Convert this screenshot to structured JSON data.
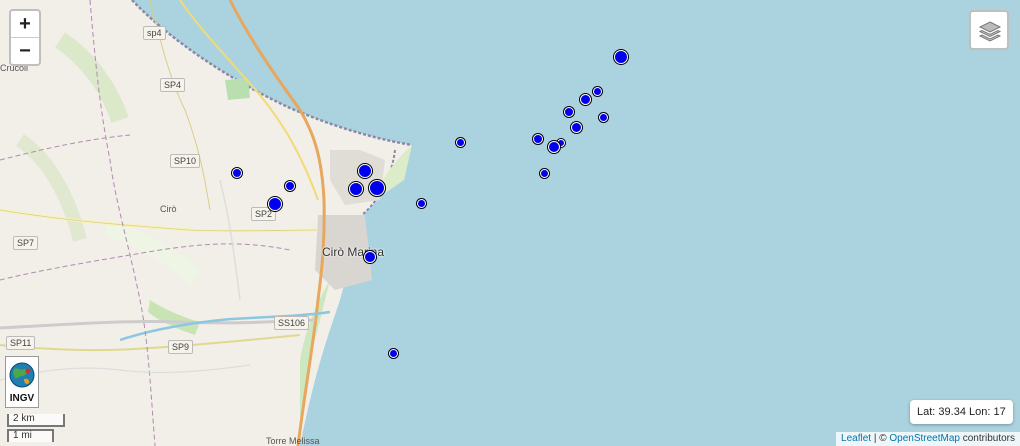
{
  "map": {
    "zoom_in_label": "+",
    "zoom_out_label": "−",
    "layers_icon": "layers-icon",
    "road_labels": [
      "sp4",
      "SP4",
      "SP10",
      "SP2",
      "SP7",
      "SS106",
      "SP9",
      "SP11"
    ],
    "place_labels": [
      "Crucoli",
      "Cirò",
      "Torre Melissa"
    ],
    "town_label": "Cirò Marina",
    "logo": {
      "text": "INGV",
      "icon": "ingv-globe-icon"
    },
    "scale": {
      "metric": "2 km",
      "imperial": "1 mi"
    },
    "coordinates": "Lat: 39.34 Lon: 17",
    "attribution": {
      "leaflet": "Leaflet",
      "separator": " | © ",
      "osm": "OpenStreetMap",
      "suffix": " contributors"
    },
    "colors": {
      "sea": "#aad3df",
      "land": "#f2efe9",
      "marker": "#0000ee"
    },
    "earthquake_markers": [
      {
        "id": "e1",
        "magnitude_class": "large"
      },
      {
        "id": "e2",
        "magnitude_class": "medium"
      },
      {
        "id": "e3",
        "magnitude_class": "medium"
      },
      {
        "id": "e4",
        "magnitude_class": "small"
      },
      {
        "id": "e5",
        "magnitude_class": "medium"
      },
      {
        "id": "e6",
        "magnitude_class": "small"
      },
      {
        "id": "e7",
        "magnitude_class": "medium"
      },
      {
        "id": "e8",
        "magnitude_class": "small"
      },
      {
        "id": "e9",
        "magnitude_class": "small"
      },
      {
        "id": "e10",
        "magnitude_class": "medium"
      },
      {
        "id": "e11",
        "magnitude_class": "small"
      },
      {
        "id": "e12",
        "magnitude_class": "small"
      },
      {
        "id": "e13",
        "magnitude_class": "small"
      },
      {
        "id": "e14",
        "magnitude_class": "small"
      },
      {
        "id": "e15",
        "magnitude_class": "large"
      },
      {
        "id": "e16",
        "magnitude_class": "large"
      },
      {
        "id": "e17",
        "magnitude_class": "large"
      },
      {
        "id": "e18",
        "magnitude_class": "medium"
      },
      {
        "id": "e19",
        "magnitude_class": "small"
      },
      {
        "id": "e20",
        "magnitude_class": "medium"
      },
      {
        "id": "e21",
        "magnitude_class": "small"
      }
    ]
  }
}
